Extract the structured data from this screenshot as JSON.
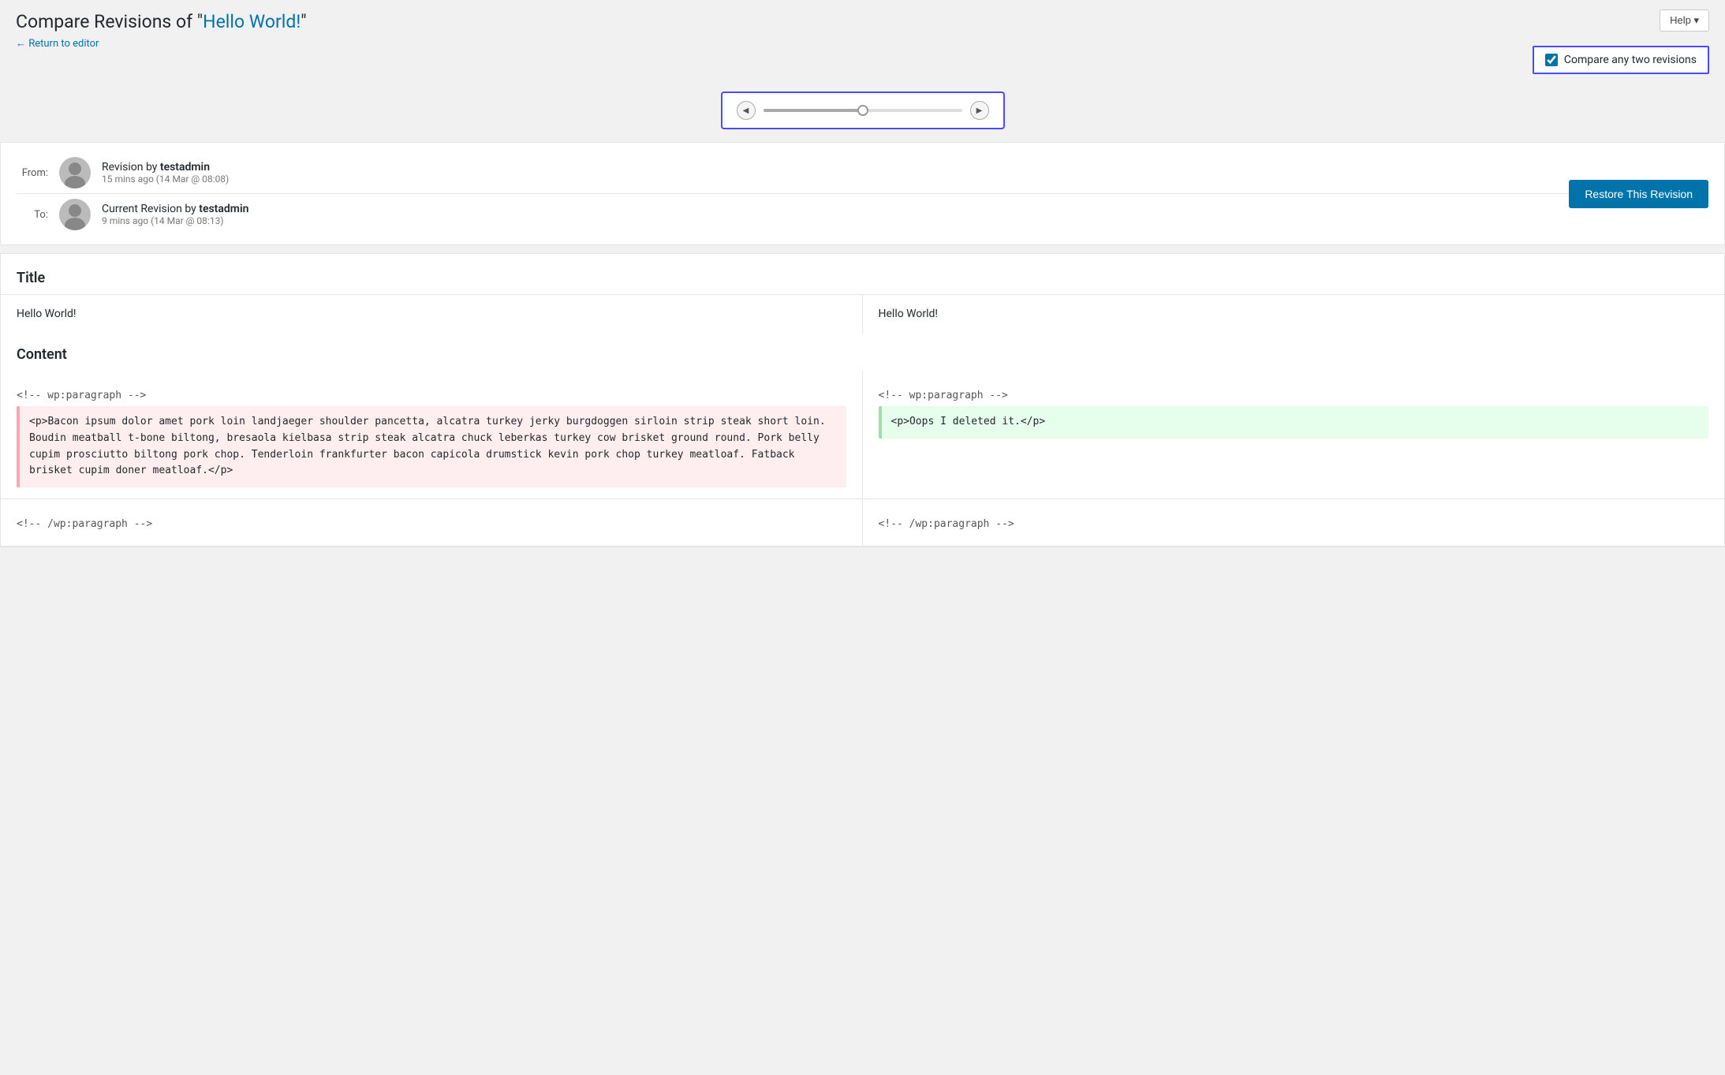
{
  "header": {
    "title_prefix": "Compare Revisions of \"",
    "title_link": "Hello World!",
    "title_suffix": "\"",
    "return_link": "← Return to editor",
    "help_button": "Help ▾"
  },
  "compare_checkbox": {
    "label": "Compare any two revisions",
    "checked": true
  },
  "slider": {
    "left_arrow": "◀",
    "right_arrow": "▶"
  },
  "from_revision": {
    "label": "From:",
    "author": "testadmin",
    "prefix": "Revision by ",
    "time_ago": "15 mins ago",
    "date": "(14 Mar @ 08:08)"
  },
  "to_revision": {
    "label": "To:",
    "prefix": "Current Revision by ",
    "author": "testadmin",
    "time_ago": "9 mins ago",
    "date": "(14 Mar @ 08:13)"
  },
  "restore_button": "Restore This Revision",
  "diff": {
    "title_section": "Title",
    "from_title": "Hello World!",
    "to_title": "Hello World!",
    "content_section": "Content",
    "from_comment1": "<!-- wp:paragraph -->",
    "to_comment1": "<!-- wp:paragraph -->",
    "from_removed_text": "<p>Bacon ipsum dolor amet pork loin landjaeger shoulder pancetta, alcatra turkey jerky burgdoggen sirloin strip steak short loin. Boudin meatball t-bone biltong, bresaola kielbasa strip steak alcatra chuck leberkas turkey cow brisket ground round. Pork belly cupim prosciutto biltong pork chop. Tenderloin frankfurter bacon capicola drumstick kevin pork chop turkey meatloaf. Fatback brisket cupim doner meatloaf.</p>",
    "to_added_text": "<p>Oops I deleted it.</p>",
    "from_comment2": "<!-- /wp:paragraph -->",
    "to_comment2": "<!-- /wp:paragraph -->"
  }
}
